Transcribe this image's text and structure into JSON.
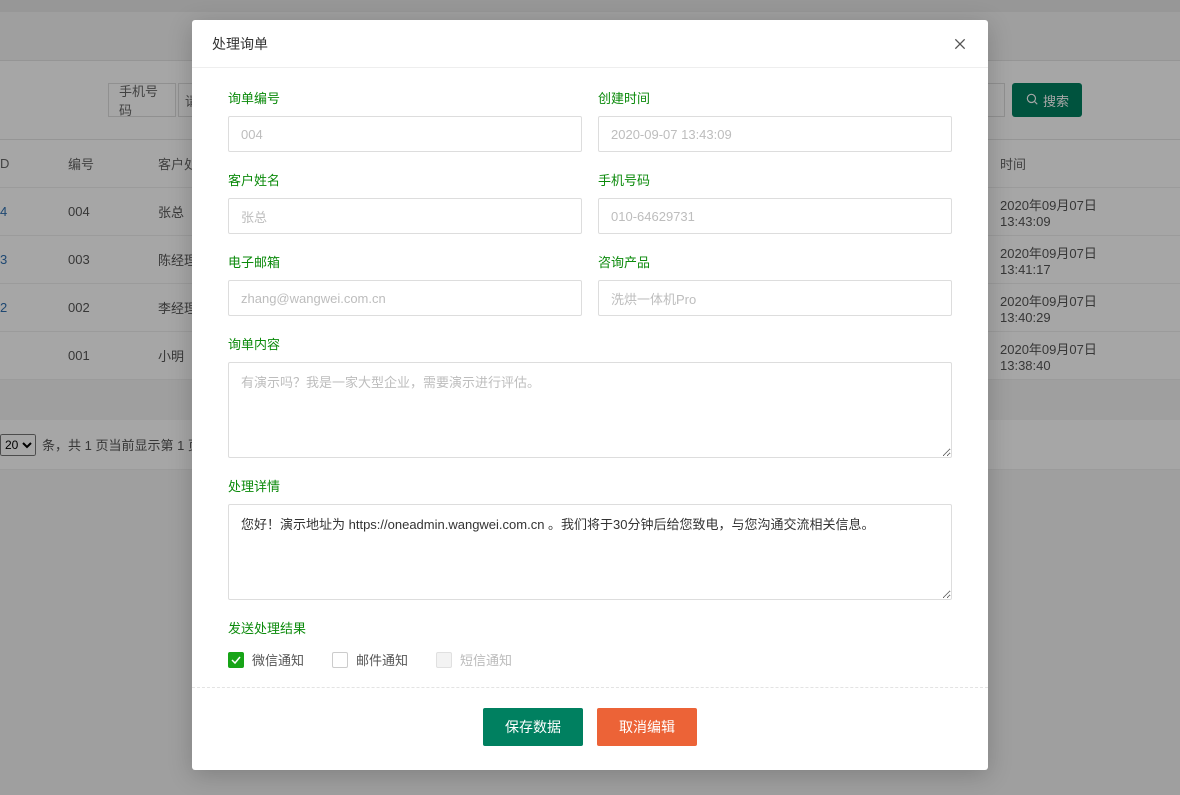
{
  "bgFilter": {
    "phoneLabel": "手机号码",
    "selectLabel": "请",
    "searchLabel": "搜索"
  },
  "bgTable": {
    "headers": {
      "id": "D",
      "num": "编号",
      "name": "客户处",
      "time": "时间"
    },
    "rows": [
      {
        "id": "4",
        "num": "004",
        "name": "张总",
        "time": "2020年09月07日 13:43:09"
      },
      {
        "id": "3",
        "num": "003",
        "name": "陈经理",
        "time": "2020年09月07日 13:41:17"
      },
      {
        "id": "2",
        "num": "002",
        "name": "李经理",
        "time": "2020年09月07日 13:40:29"
      },
      {
        "id": "",
        "num": "001",
        "name": "小明",
        "time": "2020年09月07日 13:38:40"
      }
    ]
  },
  "bgPager": {
    "perPageValue": "20",
    "text": "条，共 1 页当前显示第 1 页。"
  },
  "modal": {
    "title": "处理询单",
    "fields": {
      "inquiry_no": {
        "label": "询单编号",
        "value": "004"
      },
      "created_at": {
        "label": "创建时间",
        "value": "2020-09-07 13:43:09"
      },
      "customer_name": {
        "label": "客户姓名",
        "value": "张总"
      },
      "phone": {
        "label": "手机号码",
        "value": "010-64629731"
      },
      "email": {
        "label": "电子邮箱",
        "value": "zhang@wangwei.com.cn"
      },
      "product": {
        "label": "咨询产品",
        "value": "洗烘一体机Pro"
      },
      "content": {
        "label": "询单内容",
        "value": "有演示吗？我是一家大型企业，需要演示进行评估。"
      },
      "detail": {
        "label": "处理详情",
        "value": "您好！演示地址为 https://oneadmin.wangwei.com.cn 。我们将于30分钟后给您致电，与您沟通交流相关信息。"
      },
      "send_result": {
        "label": "发送处理结果"
      }
    },
    "checkboxes": {
      "wechat": "微信通知",
      "email": "邮件通知",
      "sms": "短信通知"
    },
    "buttons": {
      "save": "保存数据",
      "cancel": "取消编辑"
    }
  }
}
